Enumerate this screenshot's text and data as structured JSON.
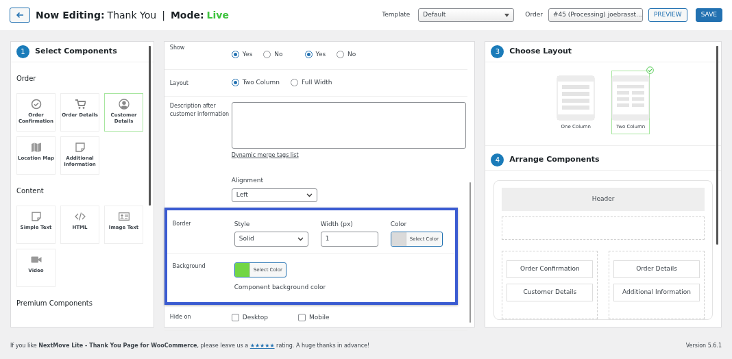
{
  "header": {
    "title_label": "Now Editing:",
    "title_value": "Thank You",
    "separator": "|",
    "mode_label": "Mode:",
    "mode_value": "Live",
    "template_label": "Template",
    "template_value": "Default",
    "order_label": "Order",
    "order_value": "#45 (Processing) joebrasst...",
    "preview_button": "PREVIEW",
    "save_button": "SAVE"
  },
  "select_components": {
    "step": "1",
    "title": "Select Components",
    "sections": [
      {
        "heading": "Order",
        "items": [
          {
            "label": "Order Confirmation",
            "selected": false
          },
          {
            "label": "Order Details",
            "selected": false
          },
          {
            "label": "Customer Details",
            "selected": true
          },
          {
            "label": "Location Map",
            "selected": false
          },
          {
            "label": "Additional Information",
            "selected": false
          }
        ]
      },
      {
        "heading": "Content",
        "items": [
          {
            "label": "Simple Text",
            "selected": false
          },
          {
            "label": "HTML",
            "selected": false
          },
          {
            "label": "Image Text",
            "selected": false
          },
          {
            "label": "Video",
            "selected": false
          }
        ]
      },
      {
        "heading": "Premium Components"
      }
    ]
  },
  "settings": {
    "rows": [
      {
        "kind": "radios",
        "label": "Show",
        "groups": [
          [
            {
              "label": "Yes",
              "selected": true
            },
            {
              "label": "No",
              "selected": false
            }
          ],
          [
            {
              "label": "Yes",
              "selected": true
            },
            {
              "label": "No",
              "selected": false
            }
          ]
        ]
      },
      {
        "kind": "radios",
        "label": "Layout",
        "groups": [
          [
            {
              "label": "Two Column",
              "selected": true
            },
            {
              "label": "Full Width",
              "selected": false
            }
          ]
        ]
      },
      {
        "kind": "textarea",
        "label": "Description after customer information",
        "link": "Dynamic merge tags list",
        "sub_label": "Alignment",
        "select_value": "Left"
      },
      {
        "kind": "border",
        "label": "Border",
        "highlighted": true,
        "style_label": "Style",
        "style_value": "Solid",
        "width_label": "Width (px)",
        "width_value": "1",
        "color_label": "Color",
        "color": "#dadada",
        "color_button": "Select Color"
      },
      {
        "kind": "background",
        "label": "Background",
        "highlighted": true,
        "color": "#72d645",
        "color_button": "Select Color",
        "help": "Component background color"
      },
      {
        "kind": "checks",
        "label": "Hide on",
        "options": [
          {
            "label": "Desktop",
            "checked": false
          },
          {
            "label": "Mobile",
            "checked": false
          }
        ]
      }
    ]
  },
  "choose_layout": {
    "step": "3",
    "title": "Choose Layout",
    "layouts": [
      {
        "label": "One Column",
        "kind": "one",
        "selected": false
      },
      {
        "label": "Two Column",
        "kind": "two",
        "selected": true
      }
    ]
  },
  "arrange": {
    "step": "4",
    "title": "Arrange Components",
    "header": "Header",
    "left_column": [
      "Order Confirmation",
      "Customer Details"
    ],
    "right_column": [
      "Order Details",
      "Additional Information"
    ]
  },
  "footer": {
    "before": "If you like **NextMove Lite - Thank You Page for WooCommerce**, please leave us a",
    "link": "★★★★★",
    "after": "rating. A huge thanks in advance!",
    "version": "Version 5.6.1"
  }
}
